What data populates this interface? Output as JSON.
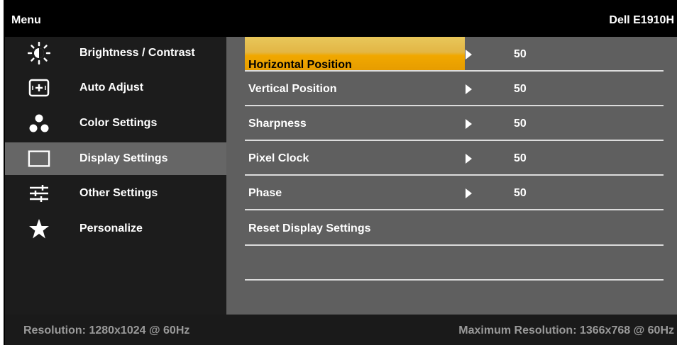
{
  "header": {
    "menu_title": "Menu",
    "model": "Dell E1910H"
  },
  "sidebar": {
    "items": [
      {
        "label": "Brightness / Contrast",
        "icon": "brightness-icon"
      },
      {
        "label": "Auto Adjust",
        "icon": "auto-adjust-icon"
      },
      {
        "label": "Color Settings",
        "icon": "color-settings-icon"
      },
      {
        "label": "Display Settings",
        "icon": "display-icon",
        "active": true
      },
      {
        "label": "Other Settings",
        "icon": "sliders-icon"
      },
      {
        "label": "Personalize",
        "icon": "star-icon"
      }
    ]
  },
  "panel": {
    "rows": [
      {
        "label": "Horizontal Position",
        "value": "50",
        "highlighted": true
      },
      {
        "label": "Vertical Position",
        "value": "50"
      },
      {
        "label": "Sharpness",
        "value": "50"
      },
      {
        "label": "Pixel Clock",
        "value": "50"
      },
      {
        "label": "Phase",
        "value": "50"
      },
      {
        "label": "Reset Display Settings",
        "value": ""
      }
    ]
  },
  "footer": {
    "resolution": "Resolution: 1280x1024 @ 60Hz",
    "max_resolution": "Maximum Resolution: 1366x768 @ 60Hz"
  },
  "colors": {
    "highlight": "#f1a800",
    "active_sidebar": "#666666",
    "panel": "#5f5f5f"
  }
}
